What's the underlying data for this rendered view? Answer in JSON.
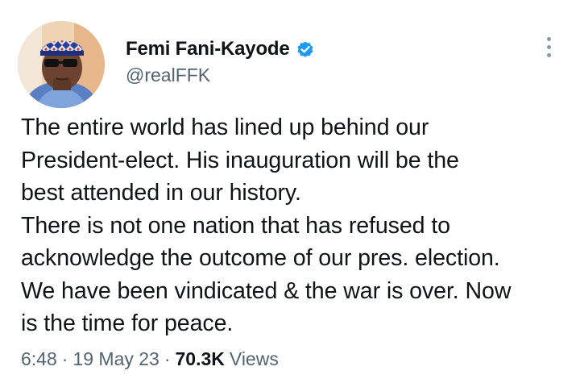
{
  "author": {
    "display_name": "Femi Fani-Kayode",
    "handle": "@realFFK",
    "verified": true,
    "avatar_icon": "profile-photo"
  },
  "tweet": {
    "lines": [
      "The entire world has lined up behind our",
      "President-elect. His inauguration will be the",
      "best attended in our history.",
      "There is not one nation that has refused to",
      "acknowledge the outcome of our pres. election.",
      "We have been vindicated & the war is over. Now",
      "is the time for peace."
    ]
  },
  "meta": {
    "time": "6:48",
    "separator": "·",
    "date": "19 May 23",
    "view_count": "70.3K",
    "views_label": "Views"
  },
  "colors": {
    "text": "#0f1419",
    "secondary": "#536471",
    "verified_blue": "#1d9bf0"
  },
  "icons": {
    "more": "more-vertical-icon",
    "verified": "verified-badge-icon"
  }
}
